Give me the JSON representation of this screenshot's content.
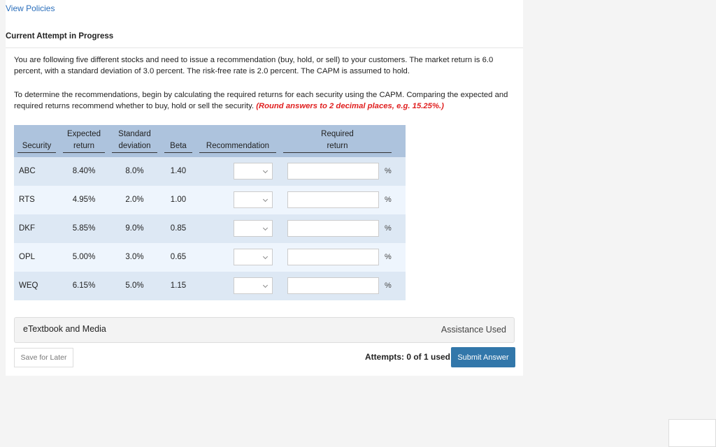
{
  "header": {
    "view_policies": "View Policies",
    "attempt_title": "Current Attempt in Progress"
  },
  "question": {
    "para1": "You are following five different stocks and need to issue a recommendation (buy, hold, or sell) to your customers. The market return is 6.0 percent, with a standard deviation of 3.0 percent. The risk-free rate is 2.0 percent. The CAPM is assumed to hold.",
    "para2": "To determine the recommendations, begin by calculating the required returns for each security using the CAPM. Comparing the expected and required returns recommend whether to buy, hold or sell the security.",
    "instruction": "(Round answers to 2 decimal places, e.g. 15.25%.)"
  },
  "table": {
    "headers": {
      "security": "Security",
      "expected1": "Expected",
      "expected2": "return",
      "std1": "Standard",
      "std2": "deviation",
      "beta": "Beta",
      "recommendation": "Recommendation",
      "required1": "Required",
      "required2": "return"
    },
    "unit": "%",
    "rows": [
      {
        "security": "ABC",
        "expected": "8.40%",
        "std": "8.0%",
        "beta": "1.40",
        "recommendation": "",
        "required": ""
      },
      {
        "security": "RTS",
        "expected": "4.95%",
        "std": "2.0%",
        "beta": "1.00",
        "recommendation": "",
        "required": ""
      },
      {
        "security": "DKF",
        "expected": "5.85%",
        "std": "9.0%",
        "beta": "0.85",
        "recommendation": "",
        "required": ""
      },
      {
        "security": "OPL",
        "expected": "5.00%",
        "std": "3.0%",
        "beta": "0.65",
        "recommendation": "",
        "required": ""
      },
      {
        "security": "WEQ",
        "expected": "6.15%",
        "std": "5.0%",
        "beta": "1.15",
        "recommendation": "",
        "required": ""
      }
    ]
  },
  "footer": {
    "etextbook": "eTextbook and Media",
    "assistance": "Assistance Used",
    "save": "Save for Later",
    "attempts": "Attempts: 0 of 1 used",
    "submit": "Submit Answer"
  },
  "colors": {
    "header_bg": "#adc3dd",
    "row_dark": "#dde8f4",
    "row_light": "#eef5fd",
    "submit": "#3277aa",
    "link": "#2a6ebb",
    "instruction": "#e02020"
  }
}
